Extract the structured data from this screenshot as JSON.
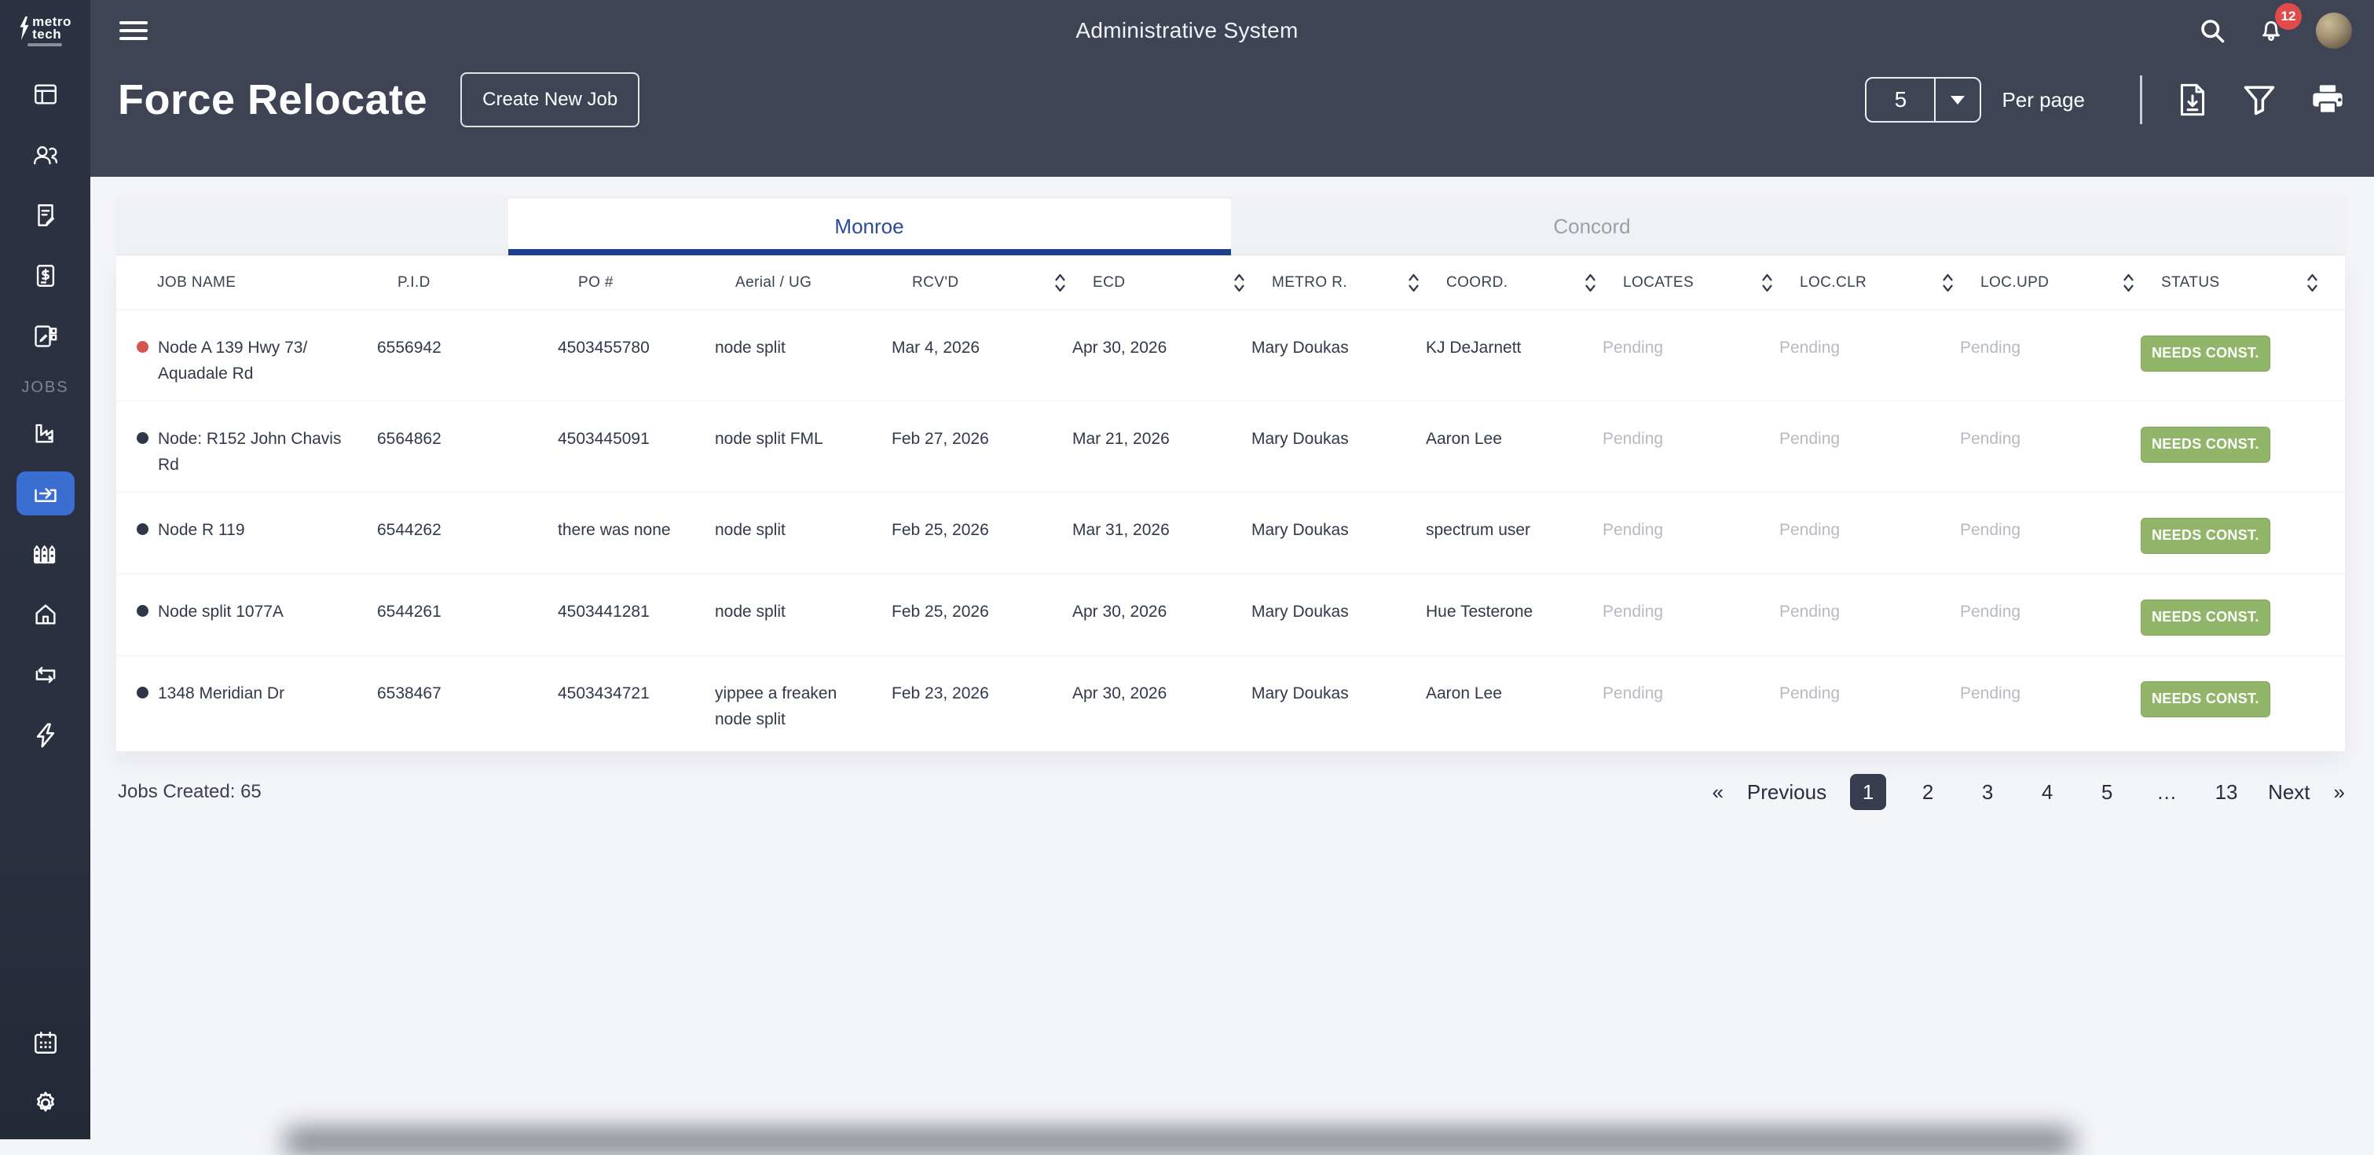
{
  "logo": {
    "line1": "metro",
    "line2": "tech"
  },
  "header": {
    "title": "Administrative System",
    "notification_count": "12"
  },
  "page": {
    "title": "Force Relocate",
    "create_job_label": "Create New Job",
    "per_page_value": "5",
    "per_page_label": "Per page"
  },
  "sidebar": {
    "jobs_label": "JOBS"
  },
  "tabs": {
    "items": [
      {
        "label": "Monroe",
        "active": true
      },
      {
        "label": "Concord",
        "active": false
      }
    ]
  },
  "table": {
    "columns": [
      {
        "label": "JOB NAME",
        "field": "job_name",
        "sortable": false
      },
      {
        "label": "P.I.D",
        "field": "pid",
        "sortable": false
      },
      {
        "label": "PO #",
        "field": "po_number",
        "sortable": false
      },
      {
        "label": "Aerial / UG",
        "field": "aerial_ug",
        "sortable": false
      },
      {
        "label": "RCV'D",
        "field": "rcvd",
        "sortable": true
      },
      {
        "label": "ECD",
        "field": "ecd",
        "sortable": true
      },
      {
        "label": "METRO R.",
        "field": "metro_r",
        "sortable": true
      },
      {
        "label": "COORD.",
        "field": "coord",
        "sortable": true
      },
      {
        "label": "LOCATES",
        "field": "locates",
        "sortable": true
      },
      {
        "label": "LOC.CLR",
        "field": "loc_clr",
        "sortable": true
      },
      {
        "label": "LOC.UPD",
        "field": "loc_upd",
        "sortable": true
      },
      {
        "label": "STATUS",
        "field": "status",
        "sortable": true
      }
    ],
    "rows": [
      {
        "dot": "red",
        "job_name": "Node A 139 Hwy 73/ Aquadale Rd",
        "pid": "6556942",
        "po_number": "4503455780",
        "aerial_ug": "node split",
        "rcvd": "Mar 4, 2026",
        "ecd": "Apr 30, 2026",
        "metro_r": "Mary Doukas",
        "coord": "KJ DeJarnett",
        "locates": "Pending",
        "loc_clr": "Pending",
        "loc_upd": "Pending",
        "status": "NEEDS CONST."
      },
      {
        "dot": "dark",
        "job_name": "Node: R152 John Chavis Rd",
        "pid": "6564862",
        "po_number": "4503445091",
        "aerial_ug": "node split FML",
        "rcvd": "Feb 27, 2026",
        "ecd": "Mar 21, 2026",
        "metro_r": "Mary Doukas",
        "coord": "Aaron Lee",
        "locates": "Pending",
        "loc_clr": "Pending",
        "loc_upd": "Pending",
        "status": "NEEDS CONST."
      },
      {
        "dot": "dark",
        "job_name": "Node R 119",
        "pid": "6544262",
        "po_number": "there was none",
        "aerial_ug": "node split",
        "rcvd": "Feb 25, 2026",
        "ecd": "Mar 31, 2026",
        "metro_r": "Mary Doukas",
        "coord": "spectrum user",
        "locates": "Pending",
        "loc_clr": "Pending",
        "loc_upd": "Pending",
        "status": "NEEDS CONST."
      },
      {
        "dot": "dark",
        "job_name": "Node split 1077A",
        "pid": "6544261",
        "po_number": "4503441281",
        "aerial_ug": "node split",
        "rcvd": "Feb 25, 2026",
        "ecd": "Apr 30, 2026",
        "metro_r": "Mary Doukas",
        "coord": "Hue Testerone",
        "locates": "Pending",
        "loc_clr": "Pending",
        "loc_upd": "Pending",
        "status": "NEEDS CONST."
      },
      {
        "dot": "dark",
        "job_name": "1348 Meridian Dr",
        "pid": "6538467",
        "po_number": "4503434721",
        "aerial_ug": "yippee a freaken node split",
        "rcvd": "Feb 23, 2026",
        "ecd": "Apr 30, 2026",
        "metro_r": "Mary Doukas",
        "coord": "Aaron Lee",
        "locates": "Pending",
        "loc_clr": "Pending",
        "loc_upd": "Pending",
        "status": "NEEDS CONST."
      }
    ]
  },
  "footer": {
    "jobs_created_label": "Jobs Created: 65"
  },
  "pagination": {
    "prev_symbol": "«",
    "prev_label": "Previous",
    "pages": [
      "1",
      "2",
      "3",
      "4",
      "5",
      "…",
      "13"
    ],
    "active_page": "1",
    "next_label": "Next",
    "next_symbol": "»"
  },
  "colors": {
    "sidebar_active_blue": "#3a6ed0",
    "tab_active_blue": "#1d3e91",
    "badge_green": "#91b669",
    "dot_red": "#d4544e",
    "dot_dark": "#2d3748",
    "notification_red": "#e14b4b"
  }
}
